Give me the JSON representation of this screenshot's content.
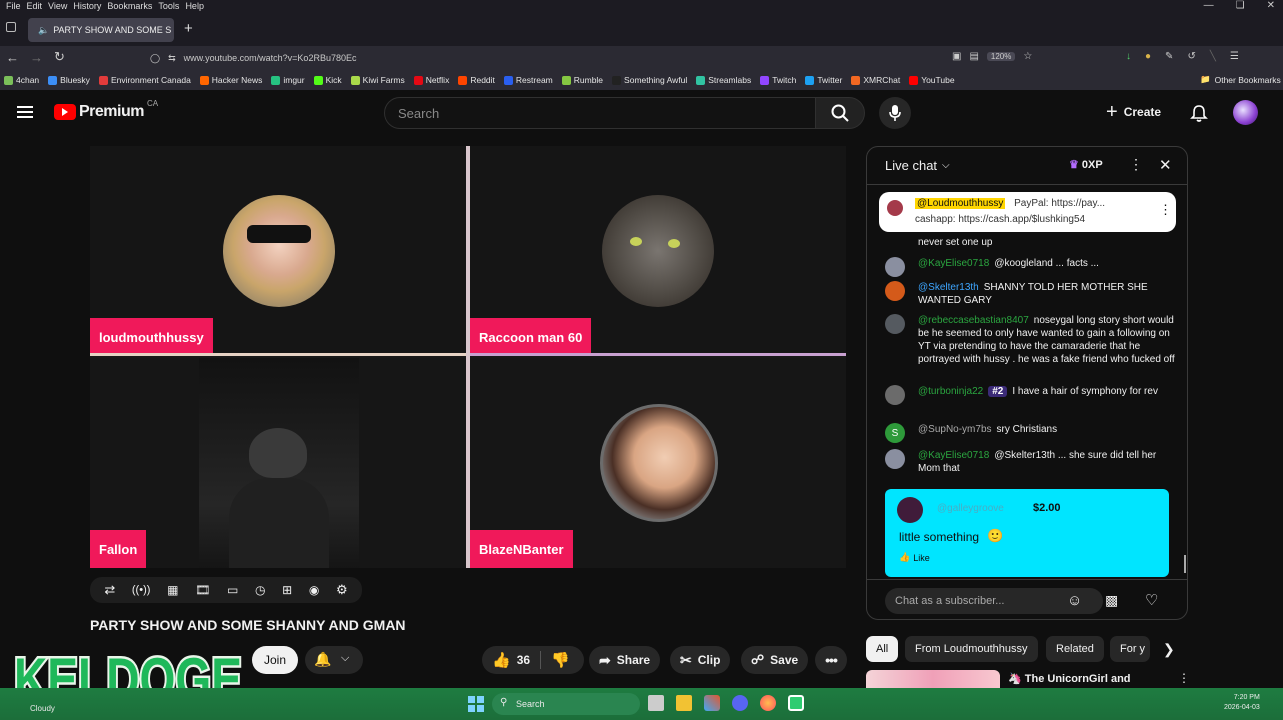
{
  "browser": {
    "menu": [
      "File",
      "Edit",
      "View",
      "History",
      "Bookmarks",
      "Tools",
      "Help"
    ],
    "tab_title": "PARTY SHOW AND SOME S",
    "url": "www.youtube.com/watch?v=Ko2RBu780Ec",
    "zoom": "120%",
    "bookmarks": [
      {
        "label": "4chan",
        "color": "#7bbf5a"
      },
      {
        "label": "Bluesky",
        "color": "#3c8ef6"
      },
      {
        "label": "Environment Canada",
        "color": "#e23b3b"
      },
      {
        "label": "Hacker News",
        "color": "#ff6600"
      },
      {
        "label": "imgur",
        "color": "#26c281"
      },
      {
        "label": "Kick",
        "color": "#53fc18"
      },
      {
        "label": "Kiwi Farms",
        "color": "#a9d94a"
      },
      {
        "label": "Netflix",
        "color": "#e50914"
      },
      {
        "label": "Reddit",
        "color": "#ff4500"
      },
      {
        "label": "Restream",
        "color": "#2a5ff0"
      },
      {
        "label": "Rumble",
        "color": "#85c742"
      },
      {
        "label": "Something Awful",
        "color": "#222222"
      },
      {
        "label": "Streamlabs",
        "color": "#31c3a2"
      },
      {
        "label": "Twitch",
        "color": "#9146ff"
      },
      {
        "label": "Twitter",
        "color": "#1da1f2"
      },
      {
        "label": "XMRChat",
        "color": "#f26822"
      },
      {
        "label": "YouTube",
        "color": "#ff0000"
      }
    ],
    "other_bookmarks": "Other Bookmarks"
  },
  "youtube": {
    "logo_text": "Premium",
    "logo_region": "CA",
    "search_placeholder": "Search",
    "create_label": "Create"
  },
  "video": {
    "participants": [
      {
        "name": "loudmouthhussy"
      },
      {
        "name": "Raccoon man 60"
      },
      {
        "name": "Fallon"
      },
      {
        "name": "BlazeNBanter"
      }
    ],
    "title": "PARTY SHOW AND SOME SHANNY AND GMAN",
    "join_label": "Join",
    "like_count": "36",
    "share_label": "Share",
    "clip_label": "Clip",
    "save_label": "Save",
    "overlay_text": "KELDOGE"
  },
  "chat": {
    "title": "Live chat",
    "xp": "0XP",
    "pinned": {
      "author": "@Loudmouthhussy",
      "line1": "PayPal: https://pay...",
      "line2": "cashapp: https://cash.app/$lushking54"
    },
    "partial_line": "never set one up",
    "messages": [
      {
        "author": "@KayElise0718",
        "text": "@koogleland ... facts ...",
        "avatar": "#8a8fa0",
        "author_color": "green"
      },
      {
        "author": "@Skelter13th",
        "text": "SHANNY TOLD HER MOTHER SHE WANTED GARY",
        "avatar": "#d45a1a",
        "author_color": "blue"
      },
      {
        "author": "@rebeccasebastian8407",
        "text": "noseygal long story short would be he seemed to only have wanted to gain a following on YT via pretending to have the camaraderie that he portrayed with hussy . he was a fake friend who fucked off",
        "avatar": "#555a60",
        "author_color": "green"
      },
      {
        "author": "@turboninja22",
        "badge": "#2",
        "text": "I have a hair of symphony for rev",
        "avatar": "#6b6b6b",
        "author_color": "green"
      },
      {
        "author": "@SupNo-ym7bs",
        "text": "sry Christians",
        "avatar": "#2e9a3a",
        "avatar_letter": "S",
        "author_color": "gray"
      },
      {
        "author": "@KayElise0718",
        "text": "@Skelter13th ... she sure did tell her Mom that",
        "avatar": "#8a8fa0",
        "author_color": "green"
      }
    ],
    "superchat": {
      "author": "@galleygroove",
      "amount": "$2.00",
      "text": "little something",
      "like_label": "Like"
    },
    "input_placeholder": "Chat as a subscriber..."
  },
  "recommendations": {
    "chips": [
      "All",
      "From Loudmouthhussy",
      "Related",
      "For y"
    ],
    "first_title": "The UnicornGirl",
    "first_title_suffix": "and"
  },
  "taskbar": {
    "weather": "Cloudy",
    "search_label": "Search",
    "time": "7:20 PM",
    "date": "2026-04-03"
  }
}
